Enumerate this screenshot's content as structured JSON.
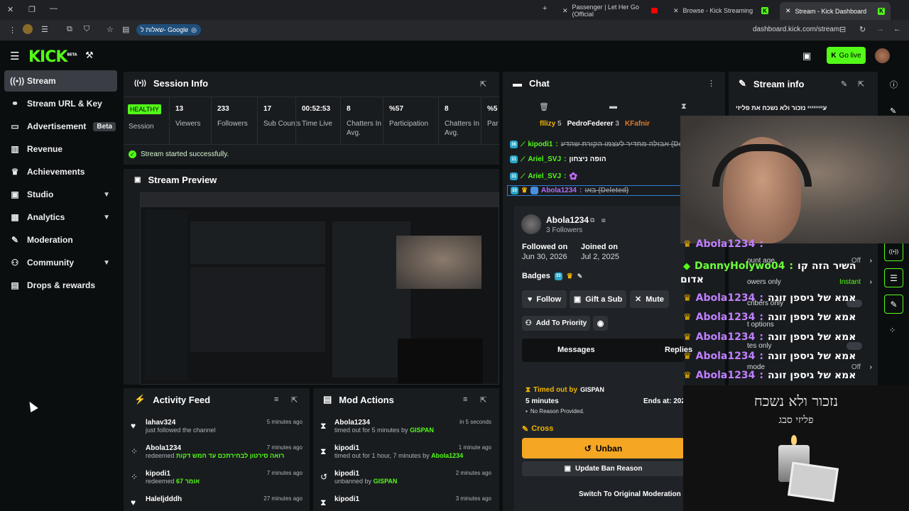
{
  "tabs": [
    {
      "title": "Passenger | Let Her Go (Official",
      "active": false
    },
    {
      "title": "Browse - Kick Streaming",
      "active": false
    },
    {
      "title": "Stream - Kick Dashboard",
      "active": true
    }
  ],
  "address": {
    "url": "dashboard.kick.com/stream",
    "search_chip": "שאלות ל- Google"
  },
  "header": {
    "logo": "KICK",
    "logo_badge": "BETA",
    "go_live": "Go live"
  },
  "sidebar": {
    "items": [
      {
        "label": "Stream",
        "icon": "broadcast-icon",
        "glyph": "((•))",
        "active": true
      },
      {
        "label": "Stream URL & Key",
        "icon": "link-icon",
        "glyph": "⚭"
      },
      {
        "label": "Advertisement",
        "icon": "tv-icon",
        "glyph": "▭",
        "badge": "Beta"
      },
      {
        "label": "Revenue",
        "icon": "chart-icon",
        "glyph": "▥"
      },
      {
        "label": "Achievements",
        "icon": "trophy-icon",
        "glyph": "♛"
      },
      {
        "label": "Studio",
        "icon": "studio-icon",
        "glyph": "▣",
        "expandable": true
      },
      {
        "label": "Analytics",
        "icon": "analytics-icon",
        "glyph": "▦",
        "expandable": true
      },
      {
        "label": "Moderation",
        "icon": "wrench-icon",
        "glyph": "✎"
      },
      {
        "label": "Community",
        "icon": "community-icon",
        "glyph": "⚇",
        "expandable": true
      },
      {
        "label": "Drops & rewards",
        "icon": "gift-icon",
        "glyph": "▤"
      }
    ]
  },
  "session": {
    "title": "Session Info",
    "status": "HEALTHY",
    "status_label": "Session",
    "stats": [
      {
        "value": "13",
        "label": "Viewers"
      },
      {
        "value": "233",
        "label": "Followers"
      },
      {
        "value": "17",
        "label": "Sub Counts"
      },
      {
        "value": "00:52:53",
        "label": "Time Live"
      },
      {
        "value": "8",
        "label": "Chatters In Avg."
      },
      {
        "value": "%57",
        "label": "Participation"
      },
      {
        "value": "8",
        "label": "Chatters In Avg."
      },
      {
        "value": "%5",
        "label": "Par"
      }
    ],
    "message": "Stream started successfully."
  },
  "preview": {
    "title": "Stream Preview"
  },
  "activity": {
    "title": "Activity Feed",
    "items": [
      {
        "name": "lahav324",
        "text": "just followed the channel",
        "extra": "",
        "time": "5 minutes ago",
        "icon": "heart-icon"
      },
      {
        "name": "Abola1234",
        "text": "redeemed",
        "extra": "רואה סירטון לבחירתכם עד חמש דקות",
        "time": "7 minutes ago",
        "icon": "redeem-icon"
      },
      {
        "name": "kipodi1",
        "text": "redeemed",
        "extra": "אומר 67",
        "time": "7 minutes ago",
        "icon": "redeem-icon"
      },
      {
        "name": "Haleljdddh",
        "text": "",
        "extra": "",
        "time": "27 minutes ago",
        "icon": "heart-icon"
      }
    ]
  },
  "modactions": {
    "title": "Mod Actions",
    "items": [
      {
        "name": "Abola1234",
        "text": "timed out for 5 minutes by",
        "by": "GISPAN",
        "time": "in 5 seconds",
        "icon": "hourglass-icon"
      },
      {
        "name": "kipodi1",
        "text": "timed out for 1 hour, 7 minutes by",
        "by": "Abola1234",
        "time": "1 minute ago",
        "icon": "hourglass-icon"
      },
      {
        "name": "kipodi1",
        "text": "unbanned by",
        "by": "GISPAN",
        "time": "2 minutes ago",
        "icon": "undo-icon"
      },
      {
        "name": "kipodi1",
        "text": "",
        "by": "",
        "time": "3 minutes ago",
        "icon": "hourglass-icon"
      }
    ]
  },
  "chat": {
    "title": "Chat",
    "top_users": [
      {
        "name": "fllizy",
        "count": "5"
      },
      {
        "name": "PedroFederer",
        "count": "3"
      },
      {
        "name": "KFafnir",
        "count": ""
      }
    ],
    "lines": [
      {
        "badge": "36",
        "user": "kipodi1",
        "color": "#53fc18",
        "text": "אבולה מחדיר לעצמו הקורת שהדע (Deleted)",
        "deleted": true
      },
      {
        "badge": "31",
        "user": "Ariel_SVJ",
        "color": "#53fc18",
        "text": "הופה ניצחון",
        "deleted": false
      },
      {
        "badge": "31",
        "user": "Ariel_SVJ",
        "color": "#53fc18",
        "text": "",
        "deleted": false
      },
      {
        "badge": "33",
        "user": "Abola1234",
        "color": "#b36bff",
        "text": "באו (Deleted)",
        "deleted": true
      }
    ]
  },
  "usercard": {
    "name": "Abola1234",
    "followers": "3 Followers",
    "followed_label": "Followed on",
    "followed_date": "Jun 30, 2026",
    "joined_label": "Joined on",
    "joined_date": "Jul 2, 2025",
    "badges_label": "Badges",
    "badge_num": "33",
    "follow": "Follow",
    "gift": "Gift a Sub",
    "mute": "Mute",
    "priority": "Add To Priority",
    "tab_messages": "Messages",
    "tab_replies": "Replies",
    "timeout_label": "Timed out by",
    "timeout_by": "GISPAN",
    "timeout_duration": "5 minutes",
    "ends_label": "Ends at: 202",
    "reason": "No Reason Provided.",
    "cross": "Cross",
    "unban": "Unban",
    "update": "Update Ban Reason",
    "switch": "Switch To Original Moderation"
  },
  "streaminfo": {
    "title": "Stream info",
    "text": "עיייייייי נזכור ולא נשכח את פליזי",
    "settings": [
      {
        "label": "ount age",
        "value": "Off"
      },
      {
        "label": "owers only",
        "value": "Instant"
      },
      {
        "label": "cribers only",
        "value": ""
      },
      {
        "label": "t options",
        "value": ""
      },
      {
        "label": "tes only",
        "value": ""
      },
      {
        "label": "mode",
        "value": "Off"
      }
    ]
  },
  "overlay": {
    "lines": [
      {
        "user": "Abola1234",
        "text": ""
      },
      {
        "user": "DannyHolywo04",
        "text": "השיר הזה קו"
      },
      {
        "user": "",
        "text": "אדום"
      },
      {
        "user": "Abola1234",
        "text": "אמא של גיספן זונה"
      },
      {
        "user": "Abola1234",
        "text": "אמא של גיספן זונה"
      },
      {
        "user": "Abola1234",
        "text": "אמא של גיספן זונה"
      },
      {
        "user": "Abola1234",
        "text": "אמא של גיספן זונה"
      },
      {
        "user": "Abola1234",
        "text": "אמא של גיספן זונה"
      }
    ],
    "memorial_title": "נזכור ולא נשכח",
    "memorial_name": "פליזי סבג"
  }
}
